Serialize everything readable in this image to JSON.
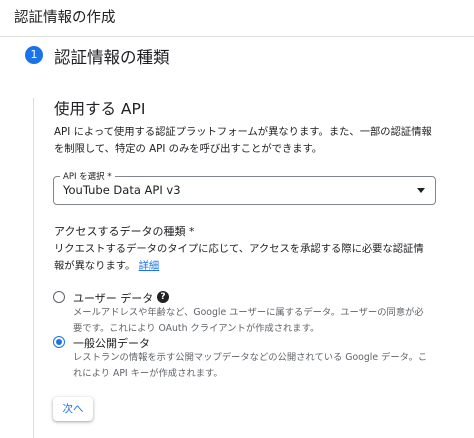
{
  "header": {
    "title": "認証情報の作成"
  },
  "step": {
    "number": "1",
    "title": "認証情報の種類"
  },
  "api_section": {
    "title": "使用する API",
    "description_line1": "API によって使用する認証プラットフォームが異なります。また、一部の認証情報",
    "description_line2": "を制限して、特定の API のみを呼び出すことができます。",
    "select_label": "API を選択 *",
    "select_value": "YouTube Data API v3"
  },
  "data_type": {
    "title": "アクセスするデータの種類 *",
    "description_line1": "リクエストするデータのタイプに応じて、アクセスを承認する際に必要な認証情",
    "description_line2": "報が異なります。",
    "link": "詳細",
    "options": [
      {
        "label": "ユーザー データ",
        "desc_line1": "メールアドレスや年齢など、Google ユーザーに属するデータ。ユーザーの同意が必",
        "desc_line2": "要です。これにより OAuth クライアントが作成されます。",
        "selected": false
      },
      {
        "label": "一般公開データ",
        "desc_line1": "レストランの情報を示す公開マップデータなどの公開されている Google データ。こ",
        "desc_line2": "れにより API キーが作成されます。",
        "selected": true
      }
    ]
  },
  "next_button": "次へ",
  "colors": {
    "accent": "#1a73e8",
    "text": "#202124",
    "muted": "#5f6368",
    "divider": "#dadce0"
  },
  "icons": {
    "help": "help-circle-icon",
    "dropdown": "dropdown-caret-icon"
  }
}
